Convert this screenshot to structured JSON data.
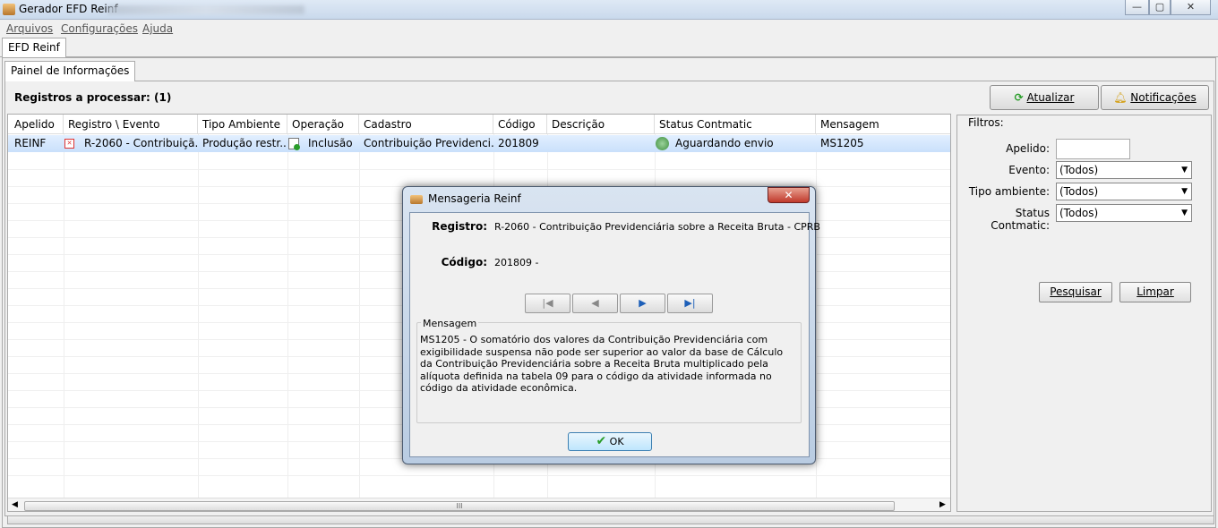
{
  "window": {
    "title": "Gerador EFD Reinf",
    "min": "—",
    "max": "▢",
    "close": "✕"
  },
  "menubar": {
    "items": [
      "Arquivos",
      "Configurações",
      "Ajuda"
    ]
  },
  "tabs": {
    "main": "EFD Reinf",
    "sub": "Painel de Informações"
  },
  "registros_label": "Registros a processar: (1)",
  "buttons": {
    "atualizar": "Atualizar",
    "notificacoes": "Notificações",
    "pesquisar": "Pesquisar",
    "limpar": "Limpar"
  },
  "grid": {
    "columns": [
      "Apelido",
      "Registro \\ Evento",
      "Tipo Ambiente",
      "Operação",
      "Cadastro",
      "Código",
      "Descrição",
      "Status Contmatic",
      "Mensagem"
    ],
    "rows": [
      {
        "apelido": "REINF",
        "registro": "R-2060 - Contribuiçã...",
        "tipo": "Produção restr...",
        "operacao": "Inclusão",
        "cadastro": "Contribuição Previdenci...",
        "codigo": "201809",
        "descricao": "",
        "status": "Aguardando envio",
        "mensagem": "MS1205"
      }
    ],
    "scroll_grip": "III"
  },
  "filters": {
    "title": "Filtros:",
    "apelido_label": "Apelido:",
    "apelido_value": "",
    "evento_label": "Evento:",
    "evento_value": "(Todos)",
    "tipo_label": "Tipo ambiente:",
    "tipo_value": "(Todos)",
    "status_label": "Status Contmatic:",
    "status_value": "(Todos)"
  },
  "dialog": {
    "title": "Mensageria Reinf",
    "registro_label": "Registro:",
    "registro_value": "R-2060 - Contribuição Previdenciária sobre a Receita Bruta - CPRB",
    "codigo_label": "Código:",
    "codigo_value": "201809 -",
    "mensagem_title": "Mensagem",
    "mensagem_text": "MS1205 - O somatório dos valores da Contribuição Previdenciária com exigibilidade suspensa não pode ser superior ao valor da base de Cálculo da Contribuição Previdenciária sobre a Receita Bruta multiplicado pela alíquota definida na tabela 09 para o código da atividade informada no código da atividade econômica.",
    "ok": "OK",
    "nav": {
      "first": "|◀",
      "prev": "◀",
      "next": "▶",
      "last": "▶|"
    }
  },
  "colors": {
    "selection": "#cce4fb",
    "accent": "#1d5fb8",
    "ok_check": "#2a9d2a"
  }
}
